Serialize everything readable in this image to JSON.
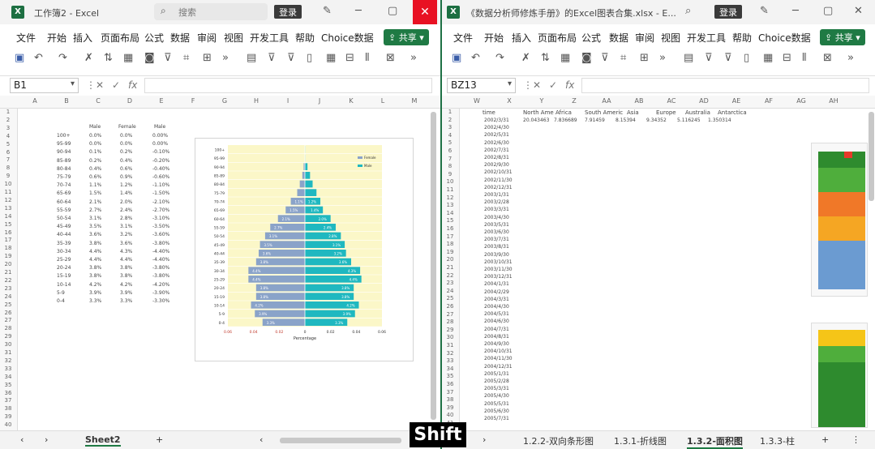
{
  "left": {
    "title": "工作簿2 - Excel",
    "search_placeholder": "搜索",
    "login": "登录",
    "menu": [
      "文件",
      "开始",
      "插入",
      "页面布局",
      "公式",
      "数据",
      "审阅",
      "视图",
      "开发工具",
      "帮助",
      "Choice数据"
    ],
    "share": "共享",
    "namebox": "B1",
    "sheet_tab": "Sheet2",
    "col_headers": [
      "A",
      "B",
      "C",
      "D",
      "E",
      "F",
      "G",
      "H",
      "I",
      "J",
      "K",
      "L",
      "M"
    ],
    "header_row": [
      "Male",
      "Female",
      "Male"
    ],
    "ages": [
      "100+",
      "95-99",
      "90-94",
      "85-89",
      "80-84",
      "75-79",
      "70-74",
      "65-69",
      "60-64",
      "55-59",
      "50-54",
      "45-49",
      "40-44",
      "35-39",
      "30-34",
      "25-29",
      "20-24",
      "15-19",
      "10-14",
      "5-9",
      "0-4"
    ],
    "male_pct": [
      "0.0%",
      "0.0%",
      "0.1%",
      "0.2%",
      "0.4%",
      "0.6%",
      "1.1%",
      "1.5%",
      "2.1%",
      "2.7%",
      "3.1%",
      "3.5%",
      "3.6%",
      "3.8%",
      "4.4%",
      "4.4%",
      "3.8%",
      "3.8%",
      "4.2%",
      "3.9%",
      "3.3%"
    ],
    "female_pct": [
      "0.0%",
      "0.0%",
      "0.2%",
      "0.4%",
      "0.6%",
      "0.9%",
      "1.2%",
      "1.4%",
      "2.0%",
      "2.4%",
      "2.8%",
      "3.1%",
      "3.2%",
      "3.6%",
      "4.3%",
      "4.4%",
      "3.8%",
      "3.8%",
      "4.2%",
      "3.9%",
      "3.3%"
    ],
    "male_neg": [
      "0.00%",
      "0.00%",
      "-0.10%",
      "-0.20%",
      "-0.40%",
      "-0.60%",
      "-1.10%",
      "-1.50%",
      "-2.10%",
      "-2.70%",
      "-3.10%",
      "-3.50%",
      "-3.60%",
      "-3.80%",
      "-4.40%",
      "-4.40%",
      "-3.80%",
      "-3.80%",
      "-4.20%",
      "-3.90%",
      "-3.30%"
    ],
    "chart_data": {
      "type": "bar",
      "orientation": "horizontal-pyramid",
      "categories": [
        "100+",
        "95-99",
        "90-94",
        "85-89",
        "80-84",
        "75-79",
        "70-74",
        "65-69",
        "60-64",
        "55-59",
        "50-54",
        "45-49",
        "40-44",
        "35-39",
        "30-34",
        "25-29",
        "20-24",
        "15-19",
        "10-14",
        "5-9",
        "0-4"
      ],
      "series": [
        {
          "name": "Female",
          "color": "#8aa3c9",
          "values": [
            0.0,
            0.0,
            -0.1,
            -0.2,
            -0.4,
            -0.6,
            -1.1,
            -1.5,
            -2.1,
            -2.7,
            -3.1,
            -3.5,
            -3.6,
            -3.8,
            -4.4,
            -4.4,
            -3.8,
            -3.8,
            -4.2,
            -3.9,
            -3.3
          ]
        },
        {
          "name": "Male",
          "color": "#1fb8c0",
          "values": [
            0.0,
            0.0,
            0.2,
            0.4,
            0.6,
            0.9,
            1.2,
            1.4,
            2.0,
            2.4,
            2.8,
            3.1,
            3.2,
            3.6,
            4.3,
            4.4,
            3.8,
            3.8,
            4.2,
            3.9,
            3.3
          ]
        }
      ],
      "xlabel": "Percentage",
      "x_ticks": [
        "0.06",
        "0.04",
        "0.02",
        "0",
        "0.02",
        "0.04",
        "0.06"
      ],
      "xlim": [
        -6,
        6
      ],
      "legend": "top-right",
      "plot_bg": "#fbf7c8"
    }
  },
  "right": {
    "title": "《数据分析师修炼手册》的Excel图表合集.xlsx - E...",
    "login": "登录",
    "menu": [
      "文件",
      "开始",
      "插入",
      "页面布局",
      "公式",
      "数据",
      "审阅",
      "视图",
      "开发工具",
      "帮助",
      "Choice数据"
    ],
    "share": "共享",
    "namebox": "BZ13",
    "col_headers": [
      "W",
      "X",
      "Y",
      "Z",
      "AA",
      "AB",
      "AC",
      "AD",
      "AE",
      "AF",
      "AG",
      "AH"
    ],
    "header": [
      "time",
      "North Ame",
      "Africa",
      "South Americ",
      "Asia",
      "Europe",
      "Australia",
      "Antarctica"
    ],
    "dates": [
      "2002/3/31",
      "2002/4/30",
      "2002/5/31",
      "2002/6/30",
      "2002/7/31",
      "2002/8/31",
      "2002/9/30",
      "2002/10/31",
      "2002/11/30",
      "2002/12/31",
      "2003/1/31",
      "2003/2/28",
      "2003/3/31",
      "2003/4/30",
      "2003/5/31",
      "2003/6/30",
      "2003/7/31",
      "2003/8/31",
      "2003/9/30",
      "2003/10/31",
      "2003/11/30",
      "2003/12/31",
      "2004/1/31",
      "2004/2/29",
      "2004/3/31",
      "2004/4/30",
      "2004/5/31",
      "2004/6/30",
      "2004/7/31",
      "2004/8/31",
      "2004/9/30",
      "2004/10/31",
      "2004/11/30",
      "2004/12/31",
      "2005/1/31",
      "2005/2/28",
      "2005/3/31",
      "2005/4/30",
      "2005/5/31",
      "2005/6/30",
      "2005/7/31"
    ],
    "row1": [
      "20.043463",
      "7.836689",
      "7.91459",
      "8.15394",
      "9.34352",
      "5.116245",
      "1.350314"
    ],
    "tabs": [
      "1.2.2-双向条形图",
      "1.3.1-折线图",
      "1.3.2-面积图",
      "1.3.3-柱"
    ],
    "active_tab": "1.3.2-面积图"
  },
  "overlay": "Shift"
}
